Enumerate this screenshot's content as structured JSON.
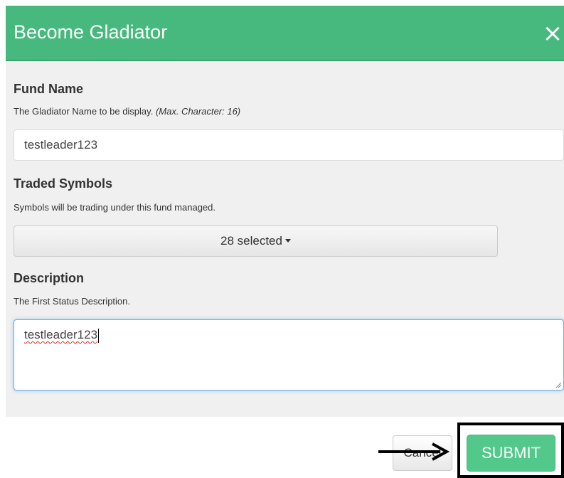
{
  "modal": {
    "title": "Become Gladiator",
    "close_icon": "close-icon"
  },
  "fund_name": {
    "label": "Fund Name",
    "help": "The Gladiator Name to be display.",
    "help_note": "(Max. Character: 16)",
    "value": "testleader123"
  },
  "traded_symbols": {
    "label": "Traded Symbols",
    "help": "Symbols will be trading under this fund managed.",
    "selected_text": "28 selected"
  },
  "description": {
    "label": "Description",
    "help": "The First Status Description.",
    "value": "testleader123"
  },
  "footer": {
    "cancel_label": "Cancel",
    "submit_label": "SUBMIT"
  },
  "annotation": {
    "arrow_icon": "right-arrow-icon"
  },
  "colors": {
    "header": "#47b97f",
    "submit": "#52c98a",
    "body_bg": "#f0f0f0"
  }
}
